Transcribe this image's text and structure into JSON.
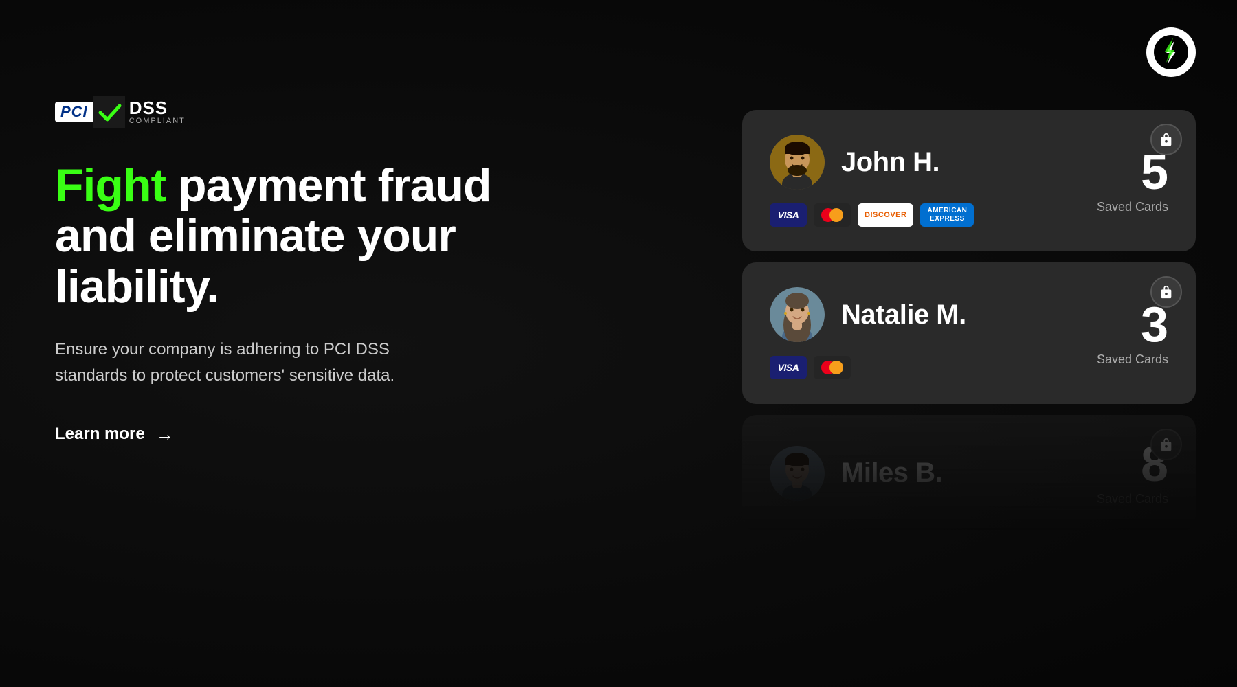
{
  "background": {
    "color": "#0a0a0a"
  },
  "brand": {
    "logo_alt": "Brand Logo"
  },
  "pci_badge": {
    "pci_text": "PCI",
    "dss_text": "DSS",
    "compliant_text": "COMPLIANT"
  },
  "hero": {
    "headline_fight": "Fight",
    "headline_rest": " payment fraud and eliminate your liability.",
    "description": "Ensure your company is adhering to PCI DSS standards to protect customers' sensitive data.",
    "learn_more_label": "Learn more",
    "arrow": "→"
  },
  "users": [
    {
      "name": "John H.",
      "saved_count": "5",
      "saved_label": "Saved Cards",
      "cards": [
        "visa",
        "mastercard",
        "discover",
        "amex"
      ],
      "avatar_type": "john"
    },
    {
      "name": "Natalie M.",
      "saved_count": "3",
      "saved_label": "Saved Cards",
      "cards": [
        "visa",
        "mastercard"
      ],
      "avatar_type": "natalie"
    },
    {
      "name": "Miles B.",
      "saved_count": "8",
      "saved_label": "Saved Cards",
      "cards": [],
      "avatar_type": "miles"
    }
  ]
}
